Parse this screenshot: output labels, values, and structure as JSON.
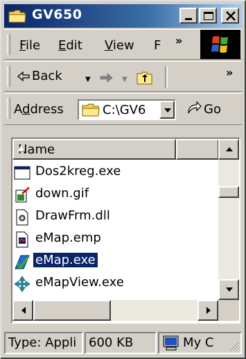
{
  "window": {
    "title": "GV650"
  },
  "menu": [
    {
      "key": "file",
      "mnemonic": "F",
      "rest": "ile"
    },
    {
      "key": "edit",
      "mnemonic": "E",
      "rest": "dit"
    },
    {
      "key": "view",
      "mnemonic": "V",
      "rest": "iew"
    },
    {
      "key": "favorites",
      "mnemonic": "",
      "rest": "F"
    }
  ],
  "overflow_chevron": "»",
  "toolbar": {
    "back_label": "Back"
  },
  "address": {
    "label_pre": "A",
    "label_mnemonic": "d",
    "label_post": "dress",
    "value": "C:\\GV6",
    "go_label": "Go"
  },
  "list": {
    "header_name": "Name",
    "files": [
      {
        "name": "Dos2kreg.exe",
        "icon": "exe-window-icon"
      },
      {
        "name": "down.gif",
        "icon": "gif-image-icon"
      },
      {
        "name": "DrawFrm.dll",
        "icon": "dll-gear-icon"
      },
      {
        "name": "eMap.emp",
        "icon": "emp-file-icon"
      },
      {
        "name": "eMap.exe",
        "icon": "emap-app-icon",
        "selected": true
      },
      {
        "name": "eMapView.exe",
        "icon": "emapview-app-icon"
      }
    ]
  },
  "status": {
    "type": "Type: Appli",
    "size": "600 KB",
    "zone": "My C"
  },
  "colors": {
    "title_start": "#0a246a",
    "title_end": "#a6caf0",
    "selection": "#0a246a",
    "face": "#d4d0c8"
  }
}
